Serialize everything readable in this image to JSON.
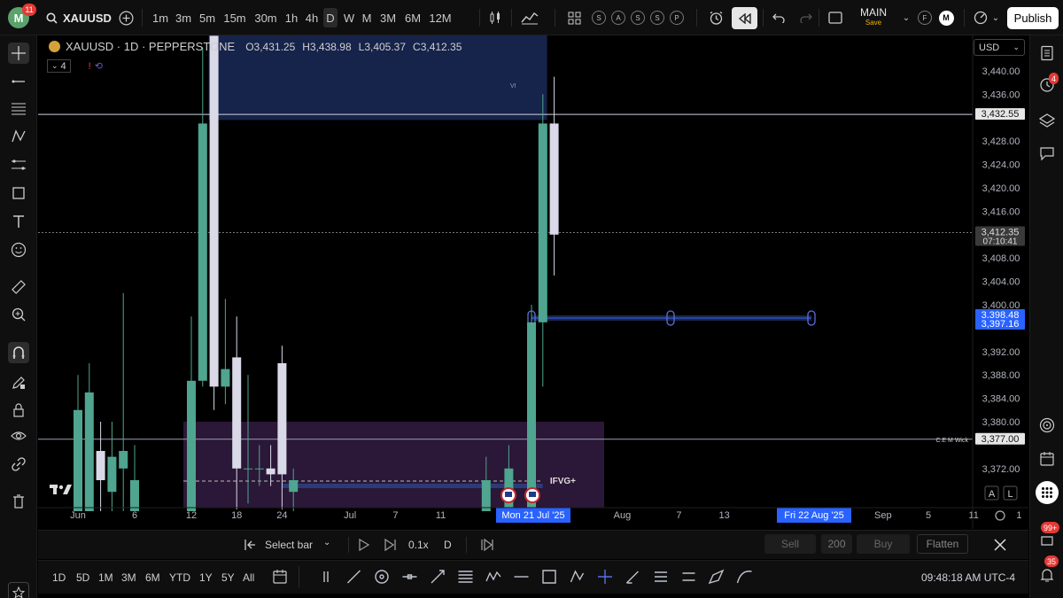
{
  "header": {
    "avatar_letter": "M",
    "notifications": "11",
    "symbol": "XAUUSD",
    "intervals": [
      "1m",
      "3m",
      "5m",
      "15m",
      "30m",
      "1h",
      "4h",
      "D",
      "W",
      "M",
      "3M",
      "6M",
      "12M"
    ],
    "active_interval": "D",
    "alert_letters": [
      "S",
      "A",
      "S",
      "S",
      "P"
    ],
    "layout_name": "MAIN",
    "layout_status": "Save",
    "publish_label": "Publish",
    "f_label": "F",
    "m_label": "M"
  },
  "legend": {
    "title": "XAUUSD · 1D · PEPPERSTONE",
    "open": "O3,431.25",
    "high": "H3,438.98",
    "low": "L3,405.37",
    "close": "C3,412.35",
    "indicator_count": "4",
    "currency": "USD"
  },
  "chart_data": {
    "type": "candlestick",
    "symbol": "XAUUSD",
    "timeframe": "1D",
    "source": "PEPPERSTONE",
    "y_ticks": [
      3440,
      3436,
      3428,
      3424,
      3420,
      3416,
      3408,
      3404,
      3400,
      3392,
      3388,
      3384,
      3380,
      3372
    ],
    "y_tick_labels": [
      "3,440.00",
      "3,436.00",
      "3,428.00",
      "3,424.00",
      "3,420.00",
      "3,416.00",
      "3,408.00",
      "3,404.00",
      "3,400.00",
      "3,392.00",
      "3,388.00",
      "3,384.00",
      "3,380.00",
      "3,372.00"
    ],
    "ylim": [
      3368,
      3444
    ],
    "x_ticks": [
      {
        "label": "Jun",
        "x": 0
      },
      {
        "label": "6",
        "x": 5
      },
      {
        "label": "12",
        "x": 10
      },
      {
        "label": "18",
        "x": 14
      },
      {
        "label": "24",
        "x": 18
      },
      {
        "label": "Jul",
        "x": 24
      },
      {
        "label": "7",
        "x": 28
      },
      {
        "label": "11",
        "x": 32
      },
      {
        "label": "Aug",
        "x": 48
      },
      {
        "label": "7",
        "x": 53
      },
      {
        "label": "13",
        "x": 57
      },
      {
        "label": "Sep",
        "x": 71
      },
      {
        "label": "5",
        "x": 75
      },
      {
        "label": "11",
        "x": 79
      },
      {
        "label": "1",
        "x": 83
      }
    ],
    "candles": [
      {
        "x": 0,
        "o": 3354,
        "h": 3388,
        "l": 3350,
        "c": 3382
      },
      {
        "x": 1,
        "o": 3350,
        "h": 3390,
        "l": 3345,
        "c": 3385
      },
      {
        "x": 2,
        "o": 3375,
        "h": 3380,
        "l": 3350,
        "c": 3370
      },
      {
        "x": 3,
        "o": 3368,
        "h": 3380,
        "l": 3360,
        "c": 3374
      },
      {
        "x": 4,
        "o": 3372,
        "h": 3402,
        "l": 3355,
        "c": 3375
      },
      {
        "x": 5,
        "o": 3360,
        "h": 3376,
        "l": 3350,
        "c": 3370
      },
      {
        "x": 10,
        "o": 3356,
        "h": 3398,
        "l": 3352,
        "c": 3387
      },
      {
        "x": 11,
        "o": 3387,
        "h": 3444,
        "l": 3386,
        "c": 3431
      },
      {
        "x": 12,
        "o": 3446,
        "h": 3446,
        "l": 3382,
        "c": 3386
      },
      {
        "x": 13,
        "o": 3386,
        "h": 3401,
        "l": 3383,
        "c": 3389
      },
      {
        "x": 14,
        "o": 3391,
        "h": 3398,
        "l": 3365,
        "c": 3372
      },
      {
        "x": 15,
        "o": 3372,
        "h": 3388,
        "l": 3366,
        "c": 3372
      },
      {
        "x": 16,
        "o": 3372,
        "h": 3376,
        "l": 3369,
        "c": 3372
      },
      {
        "x": 17,
        "o": 3372,
        "h": 3376,
        "l": 3369,
        "c": 3371
      },
      {
        "x": 18,
        "o": 3390,
        "h": 3393,
        "l": 3365,
        "c": 3371
      },
      {
        "x": 19,
        "o": 3368,
        "h": 3372,
        "l": 3362,
        "c": 3370
      },
      {
        "x": 36,
        "o": 3360,
        "h": 3374,
        "l": 3355,
        "c": 3370
      },
      {
        "x": 38,
        "o": 3360,
        "h": 3376,
        "l": 3355,
        "c": 3372
      },
      {
        "x": 40,
        "o": 3362,
        "h": 3400,
        "l": 3358,
        "c": 3397
      },
      {
        "x": 41,
        "o": 3397,
        "h": 3436,
        "l": 3386,
        "c": 3431
      },
      {
        "x": 42,
        "o": 3431,
        "h": 3439,
        "l": 3405,
        "c": 3412
      }
    ],
    "levels": [
      {
        "value": 3432.55,
        "label": "3,432.55"
      },
      {
        "value": 3412.35,
        "label": "3,412.35",
        "sub": "07:10:41"
      },
      {
        "value": 3398.48,
        "label": "3,398.48"
      },
      {
        "value": 3397.16,
        "label": "3,397.16"
      },
      {
        "value": 3377.0,
        "label": "3,377.00",
        "tag": "C.E M Wick"
      }
    ],
    "annotations": [
      "IFVG+",
      "VI"
    ],
    "crosshair_dates": [
      "Mon 21 Jul '25",
      "Fri 22 Aug '25"
    ],
    "scale_buttons": [
      "A",
      "L"
    ]
  },
  "trade_bar": {
    "select_bar": "Select bar",
    "speed": "0.1x",
    "interval": "D",
    "sell": "Sell",
    "qty": "200",
    "buy": "Buy",
    "flatten": "Flatten"
  },
  "range_bar": {
    "ranges": [
      "1D",
      "5D",
      "1M",
      "3M",
      "6M",
      "YTD",
      "1Y",
      "5Y",
      "All"
    ],
    "clock": "09:48:18 AM UTC-4"
  },
  "right_bar": {
    "badges": [
      "4",
      "99+",
      "35"
    ]
  },
  "colors": {
    "up": "#4fa58f",
    "down": "#d9d9e8",
    "zone_blue": "#1e2f63",
    "zone_purple": "#3a1f4a",
    "highlight": "#2962ff"
  }
}
